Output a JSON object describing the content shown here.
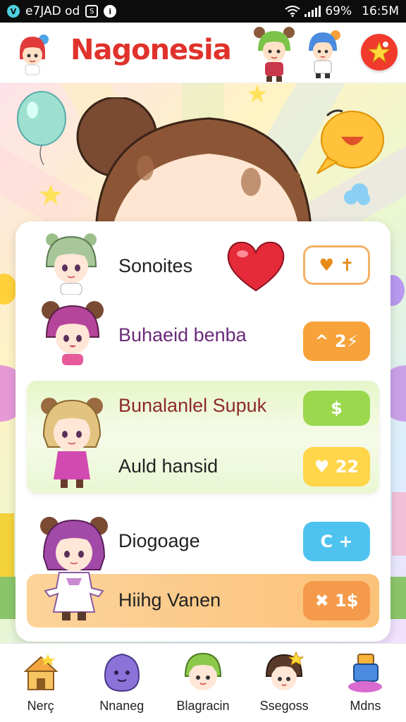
{
  "status_bar": {
    "carrier": "e7JAD od",
    "battery": "69%",
    "time": "16:5M"
  },
  "header": {
    "title": "Nagonesia"
  },
  "list": {
    "rows": [
      {
        "label": "Sonoites",
        "badge": "♥ ✝",
        "label_color": "#222222"
      },
      {
        "label": "Buhaeid benba",
        "badge": "^ 2⚡",
        "label_color": "#6b2a7a"
      },
      {
        "label": "Bunalanlel Supuk",
        "badge": "$",
        "label_color": "#8c2a2a"
      },
      {
        "label": "Auld hansid",
        "badge": "♥ 22",
        "label_color": "#222222"
      },
      {
        "label": "Diogoage",
        "badge": "C +",
        "label_color": "#222222"
      },
      {
        "label": "Hiihg Vanen",
        "badge": "✖ 1$",
        "label_color": "#222222"
      }
    ]
  },
  "bottom_nav": {
    "items": [
      {
        "label": "Nerç",
        "icon": "cake-house-icon"
      },
      {
        "label": "Nnaneg",
        "icon": "purple-monster-icon"
      },
      {
        "label": "Blagracin",
        "icon": "green-hair-avatar-icon"
      },
      {
        "label": "Ssegoss",
        "icon": "star-avatar-icon"
      },
      {
        "label": "Mdns",
        "icon": "gift-box-icon"
      }
    ]
  },
  "colors": {
    "title_red": "#e0322b",
    "accent_orange": "#f7a23a",
    "accent_green": "#9bd84e",
    "accent_yellow": "#ffd54a",
    "accent_blue": "#4fc3ef"
  }
}
